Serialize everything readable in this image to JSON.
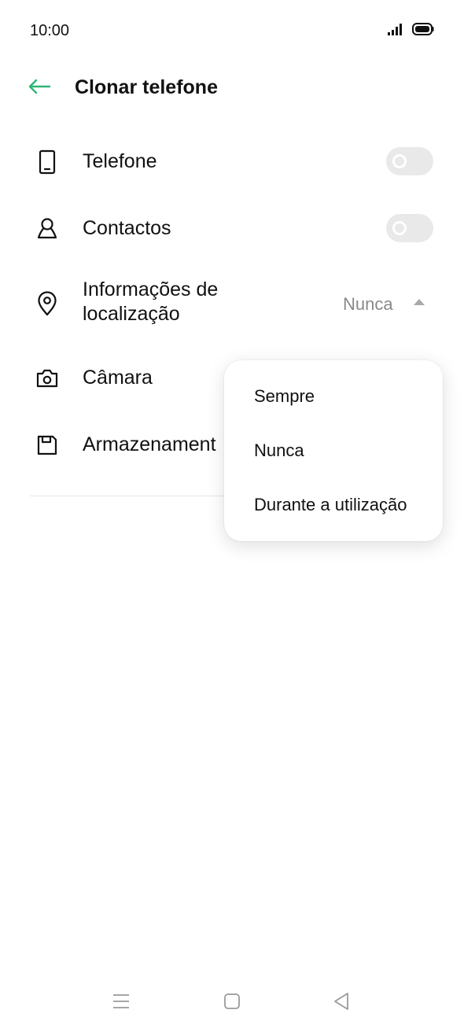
{
  "status_bar": {
    "time": "10:00",
    "signal_icon": "signal-icon",
    "battery_icon": "battery-icon"
  },
  "header": {
    "title": "Clonar telefone",
    "back_icon": "back-arrow-icon"
  },
  "colors": {
    "accent": "#2bb673",
    "toggle_off": "#e9e9e9",
    "text": "#111111",
    "secondary_text": "#8a8a8a"
  },
  "settings": [
    {
      "label": "Telefone",
      "icon": "phone-icon",
      "control": "toggle",
      "enabled": false
    },
    {
      "label": "Contactos",
      "icon": "contacts-icon",
      "control": "toggle",
      "enabled": false
    },
    {
      "label_line1": "Informações de",
      "label_line2": "localização",
      "icon": "location-icon",
      "control": "dropdown",
      "value": "Nunca"
    },
    {
      "label": "Câmara",
      "icon": "camera-icon"
    },
    {
      "label": "Armazenament",
      "icon": "storage-icon"
    }
  ],
  "dropdown_menu": {
    "options": [
      "Sempre",
      "Nunca",
      "Durante a utilização"
    ]
  },
  "nav_bar": {
    "menu_icon": "menu-icon",
    "home_icon": "home-icon",
    "back_icon": "back-triangle-icon"
  }
}
